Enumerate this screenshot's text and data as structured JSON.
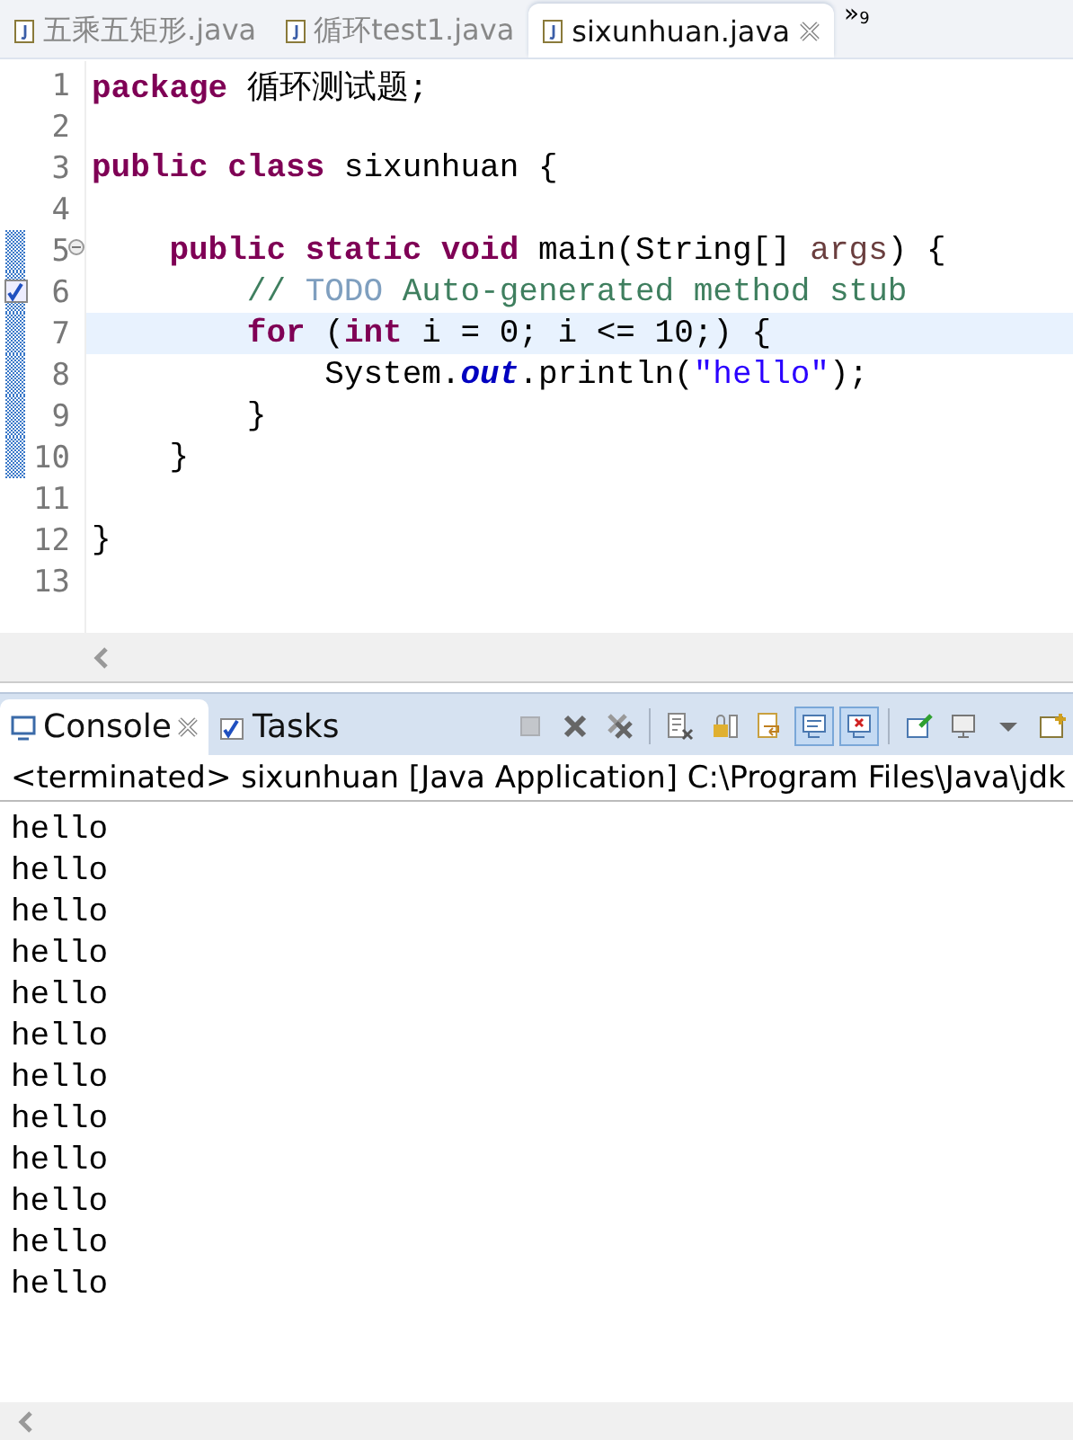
{
  "editor_tabs": [
    {
      "label": "五乘五矩形.java",
      "selected": false
    },
    {
      "label": "循环test1.java",
      "selected": false
    },
    {
      "label": "sixunhuan.java",
      "selected": true
    }
  ],
  "tab_overflow": {
    "symbol": "»",
    "count": "9"
  },
  "code_lines": [
    {
      "number": "1",
      "current": false,
      "in_range": false,
      "tokens": [
        {
          "kind": "keyword",
          "text": "package"
        },
        {
          "kind": "plain",
          "text": " 循环测试题;"
        }
      ]
    },
    {
      "number": "2",
      "current": false,
      "in_range": false
    },
    {
      "number": "3",
      "current": false,
      "in_range": false,
      "tokens": [
        {
          "kind": "keyword",
          "text": "public class"
        },
        {
          "kind": "plain",
          "text": " sixunhuan {"
        }
      ]
    },
    {
      "number": "4",
      "current": false,
      "in_range": false
    },
    {
      "number": "5",
      "current": false,
      "in_range": true,
      "fold_control": true,
      "tokens": [
        {
          "kind": "keyword",
          "text": "    public static void"
        },
        {
          "kind": "plain",
          "text": " main(String[] "
        },
        {
          "kind": "parameter",
          "text": "args"
        },
        {
          "kind": "plain",
          "text": ") {"
        }
      ]
    },
    {
      "number": "6",
      "current": false,
      "in_range": true,
      "task_marker": true,
      "tokens": [
        {
          "kind": "comment",
          "text": "        // "
        },
        {
          "kind": "todo",
          "text": "TODO"
        },
        {
          "kind": "comment",
          "text": " Auto-generated method stub"
        }
      ]
    },
    {
      "number": "7",
      "current": true,
      "in_range": true,
      "tokens": [
        {
          "kind": "keyword",
          "text": "        for"
        },
        {
          "kind": "plain",
          "text": " ("
        },
        {
          "kind": "keyword",
          "text": "int"
        },
        {
          "kind": "plain",
          "text": " i = 0; i <= 10;) {"
        }
      ]
    },
    {
      "number": "8",
      "current": false,
      "in_range": true,
      "tokens": [
        {
          "kind": "plain",
          "text": "            System."
        },
        {
          "kind": "static",
          "text": "out"
        },
        {
          "kind": "plain",
          "text": ".println("
        },
        {
          "kind": "string",
          "text": "\"hello\""
        },
        {
          "kind": "plain",
          "text": ");"
        }
      ]
    },
    {
      "number": "9",
      "current": false,
      "in_range": true,
      "tokens": [
        {
          "kind": "plain",
          "text": "        }"
        }
      ]
    },
    {
      "number": "10",
      "current": false,
      "in_range": true,
      "tokens": [
        {
          "kind": "plain",
          "text": "    }"
        }
      ]
    },
    {
      "number": "11",
      "current": false,
      "in_range": false
    },
    {
      "number": "12",
      "current": false,
      "in_range": false,
      "tokens": [
        {
          "kind": "plain",
          "text": "}"
        }
      ]
    },
    {
      "number": "13",
      "current": false,
      "in_range": false
    }
  ],
  "console": {
    "tabs": [
      {
        "label": "Console",
        "kind": "console",
        "selected": true
      },
      {
        "label": "Tasks",
        "kind": "tasks",
        "selected": false
      }
    ],
    "toolbar": [
      {
        "kind": "stop",
        "disabled": true,
        "selected": false
      },
      {
        "kind": "remove",
        "disabled": false,
        "selected": false
      },
      {
        "kind": "remove-all",
        "disabled": false,
        "selected": false
      },
      {
        "kind": "sep"
      },
      {
        "kind": "clear",
        "disabled": false,
        "selected": false
      },
      {
        "kind": "lock",
        "disabled": false,
        "selected": false
      },
      {
        "kind": "wrap",
        "disabled": false,
        "selected": false
      },
      {
        "kind": "show-out",
        "disabled": false,
        "selected": true
      },
      {
        "kind": "show-err",
        "disabled": false,
        "selected": true
      },
      {
        "kind": "sep"
      },
      {
        "kind": "pin",
        "disabled": false,
        "selected": false
      },
      {
        "kind": "display",
        "disabled": false,
        "selected": false
      },
      {
        "kind": "dropdown",
        "disabled": false,
        "selected": false
      },
      {
        "kind": "new",
        "disabled": false,
        "selected": false
      }
    ],
    "launch": "<terminated> sixunhuan [Java Application] C:\\Program Files\\Java\\jdk",
    "output": [
      "hello",
      "hello",
      "hello",
      "hello",
      "hello",
      "hello",
      "hello",
      "hello",
      "hello",
      "hello",
      "hello",
      "hello"
    ]
  }
}
